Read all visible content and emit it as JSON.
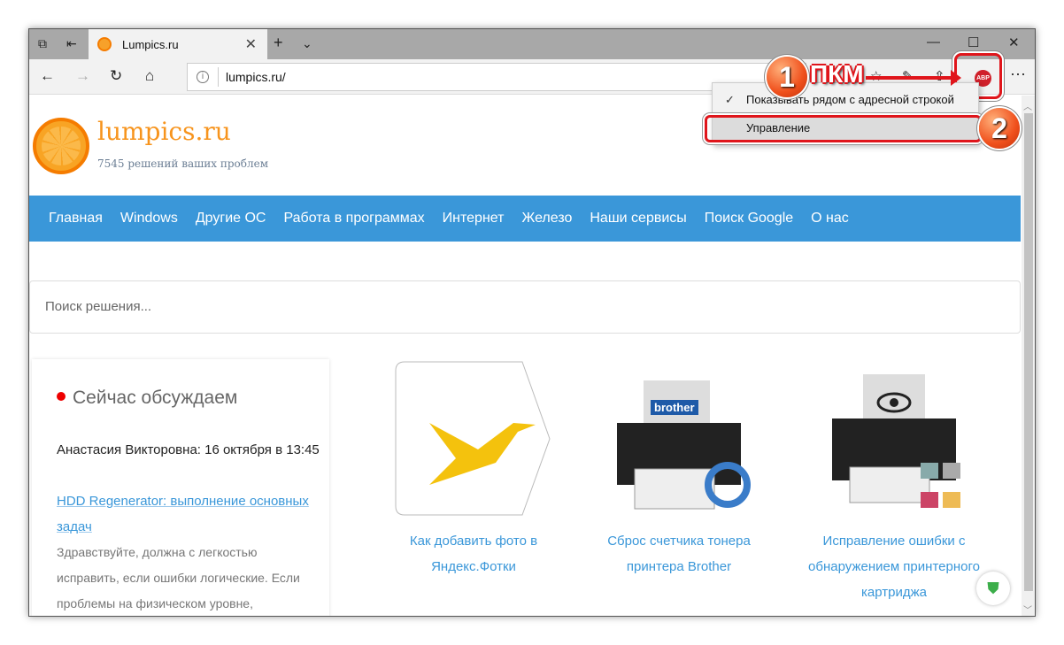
{
  "browser": {
    "tab_title": "Lumpics.ru",
    "url": "lumpics.ru/"
  },
  "context_menu": {
    "items": [
      {
        "label": "Показывать рядом с адресной строкой",
        "checked": true
      },
      {
        "label": "Управление"
      }
    ]
  },
  "annotations": {
    "step1": "1",
    "step1_label": "ПКМ",
    "step2": "2"
  },
  "extension": {
    "label": "ABP"
  },
  "site": {
    "brand": "lumpics.ru",
    "tagline": "7545 решений ваших проблем",
    "nav": [
      "Главная",
      "Windows",
      "Другие ОС",
      "Работа в программах",
      "Интернет",
      "Железо",
      "Наши сервисы",
      "Поиск Google",
      "О нас"
    ],
    "search_placeholder": "Поиск решения...",
    "sidebar": {
      "title": "Сейчас обсуждаем",
      "author": "Анастасия Викторовна: 16 октября в 13:45",
      "link": "HDD Regenerator: выполнение основных задач",
      "excerpt": "Здравствуйте, должна с легкостью исправить, если ошибки логические. Если проблемы на физическом уровне,"
    },
    "cards": [
      {
        "title": "Как добавить фото в Яндекс.Фотки"
      },
      {
        "title": "Сброс счетчика тонера принтера Brother",
        "image_text": "brother"
      },
      {
        "title": "Исправление ошибки с обнаружением принтерного картриджа"
      }
    ]
  }
}
